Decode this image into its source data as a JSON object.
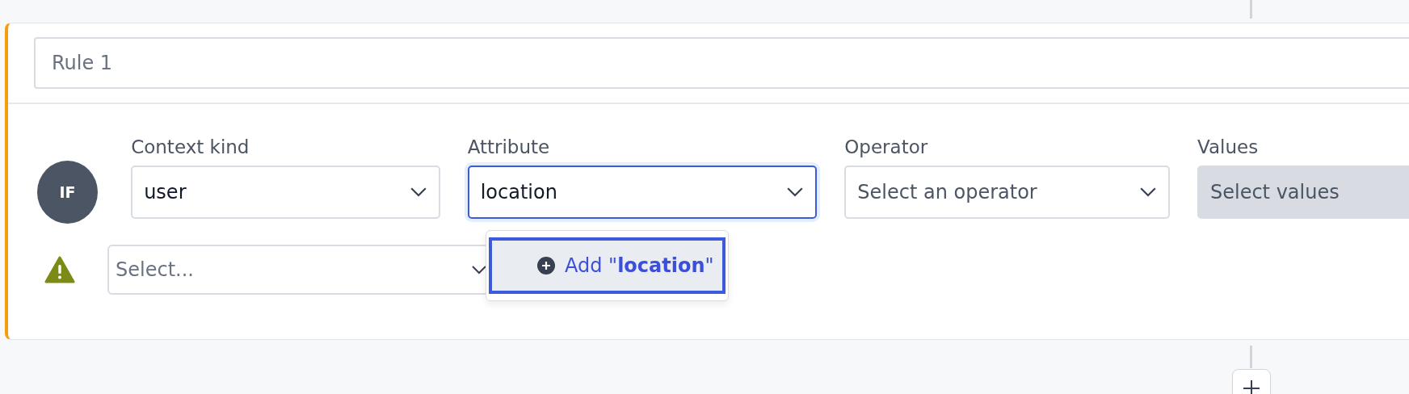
{
  "rule": {
    "name_field": {
      "placeholder": "Rule 1"
    },
    "badge": "IF",
    "fields": [
      {
        "kind": "select",
        "label": "Context kind",
        "value": "user",
        "focused": false
      },
      {
        "kind": "select",
        "label": "Attribute",
        "value": "location",
        "focused": true
      },
      {
        "kind": "select",
        "label": "Operator",
        "placeholder": "Select an operator",
        "focused": false
      },
      {
        "kind": "disabled",
        "label": "Values",
        "placeholder": "Select values",
        "focused": false
      }
    ],
    "warning_select": {
      "placeholder": "Select..."
    },
    "dropdown": {
      "options": [
        {
          "label": "Add \"**location**\"",
          "selected": true
        }
      ]
    }
  }
}
